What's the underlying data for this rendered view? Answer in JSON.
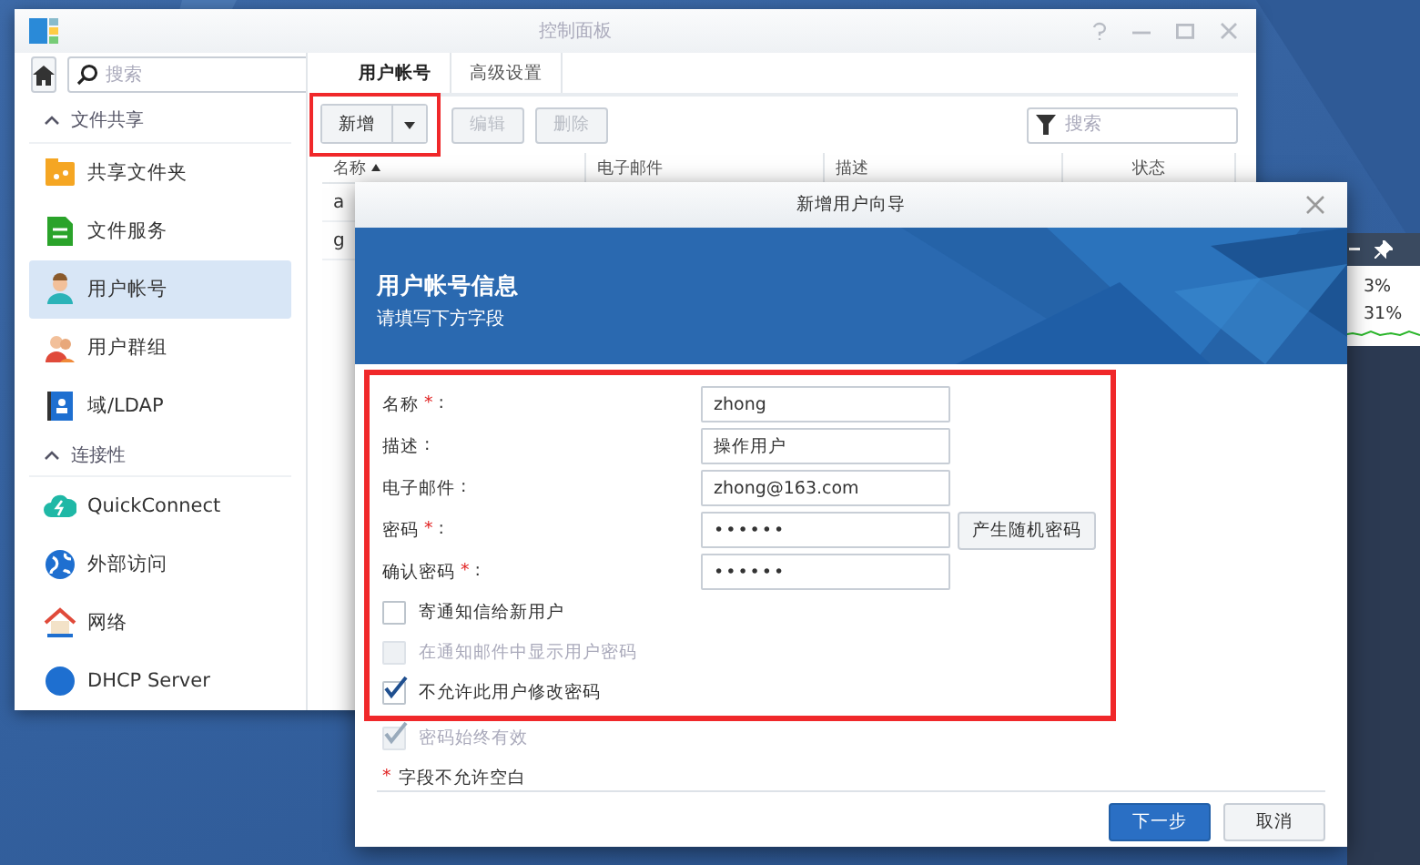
{
  "control_panel": {
    "title": "控制面板",
    "search": {
      "placeholder": "搜索"
    },
    "sidebar": [
      {
        "kind": "section",
        "label": "文件共享",
        "expanded": true
      },
      {
        "kind": "item",
        "label": "共享文件夹",
        "selected": false
      },
      {
        "kind": "item",
        "label": "文件服务",
        "selected": false
      },
      {
        "kind": "item",
        "label": "用户帐号",
        "selected": true
      },
      {
        "kind": "item",
        "label": "用户群组",
        "selected": false
      },
      {
        "kind": "item",
        "label": "域/LDAP",
        "selected": false
      },
      {
        "kind": "section",
        "label": "连接性",
        "expanded": true
      },
      {
        "kind": "item",
        "label": "QuickConnect",
        "selected": false
      },
      {
        "kind": "item",
        "label": "外部访问",
        "selected": false
      },
      {
        "kind": "item",
        "label": "网络",
        "selected": false
      },
      {
        "kind": "item",
        "label": "DHCP Server",
        "selected": false
      }
    ],
    "tabs": [
      {
        "label": "用户帐号",
        "selected": true
      },
      {
        "label": "高级设置",
        "selected": false
      }
    ],
    "toolbar": {
      "create": {
        "label": "新增",
        "highlighted": true
      },
      "buttons": [
        {
          "label": "编辑",
          "disabled": true
        },
        {
          "label": "删除",
          "disabled": true
        }
      ],
      "filter": {
        "placeholder": "搜索"
      }
    },
    "table": {
      "columns": [
        {
          "label": "名称",
          "sorted": true
        },
        {
          "label": "电子邮件"
        },
        {
          "label": "描述"
        },
        {
          "label": "状态"
        }
      ],
      "rows": [
        [
          "a"
        ],
        [
          "g"
        ]
      ]
    }
  },
  "widget": {
    "readings": [
      "3%",
      "31%"
    ]
  },
  "dialog": {
    "title": "新增用户向导",
    "heading": "用户帐号信息",
    "subheading": "请填写下方字段",
    "highlighted": true,
    "fields": [
      {
        "label": "名称",
        "required_mark": "*",
        "separator": ":",
        "kind": "text",
        "value": "zhong"
      },
      {
        "label": "描述",
        "separator": ":",
        "kind": "text",
        "value": "操作用户"
      },
      {
        "label": "电子邮件",
        "separator": ":",
        "kind": "text",
        "value": "zhong@163.com"
      },
      {
        "label": "密码",
        "required_mark": "*",
        "separator": ":",
        "kind": "password",
        "value": "••••••",
        "button": "产生随机密码"
      },
      {
        "label": "确认密码",
        "required_mark": "*",
        "separator": ":",
        "kind": "password",
        "value": "••••••"
      }
    ],
    "checkboxes": [
      {
        "label": "寄通知信给新用户",
        "checked": false,
        "disabled": false
      },
      {
        "label": "在通知邮件中显示用户密码",
        "checked": false,
        "disabled": true
      },
      {
        "label": "不允许此用户修改密码",
        "checked": true,
        "disabled": false
      }
    ],
    "more_checkboxes": [
      {
        "label": "密码始终有效",
        "checked": true,
        "disabled": true
      }
    ],
    "note_mark": "*",
    "note": "字段不允许空白",
    "buttons": [
      {
        "label": "下一步",
        "primary": true
      },
      {
        "label": "取消",
        "primary": false
      }
    ]
  }
}
